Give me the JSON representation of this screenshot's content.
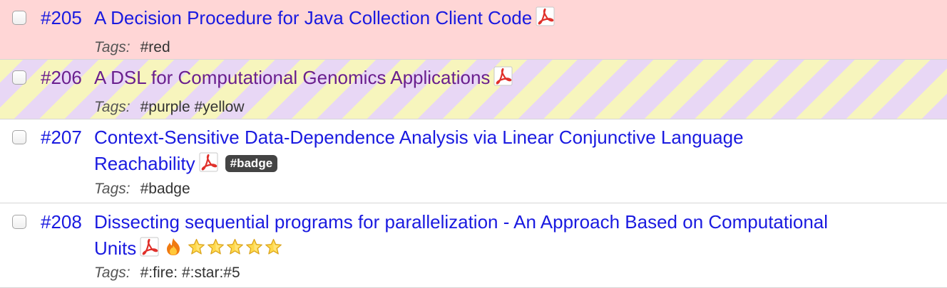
{
  "papers": [
    {
      "number": "#205",
      "title_line1": "A Decision Procedure for Java Collection Client Code",
      "has_pdf": true,
      "tags_label": "Tags:",
      "tags": "#red"
    },
    {
      "number": "#206",
      "title_line1": "A DSL for Computational Genomics Applications",
      "has_pdf": true,
      "tags_label": "Tags:",
      "tags": "#purple #yellow"
    },
    {
      "number": "#207",
      "title_line1": "Context-Sensitive Data-Dependence Analysis via Linear Conjunctive Language",
      "title_line2": "Reachability",
      "has_pdf": true,
      "badge": "#badge",
      "tags_label": "Tags:",
      "tags": "#badge"
    },
    {
      "number": "#208",
      "title_line1": "Dissecting sequential programs for parallelization - An Approach Based on Computational",
      "title_line2": "Units",
      "has_pdf": true,
      "fire": true,
      "star_rating": 5,
      "tags_label": "Tags:",
      "tags": "#:fire: #:star:#5"
    }
  ],
  "colors": {
    "link": "#1a1ae0",
    "link_purple": "#6a1f8e",
    "row_red": "#ffd6d6",
    "stripe_purple": "#e8d7f5",
    "stripe_yellow": "#f7f5bd",
    "badge_bg": "#444444"
  },
  "icons": [
    "pdf-icon",
    "fire-icon",
    "star-icon"
  ]
}
